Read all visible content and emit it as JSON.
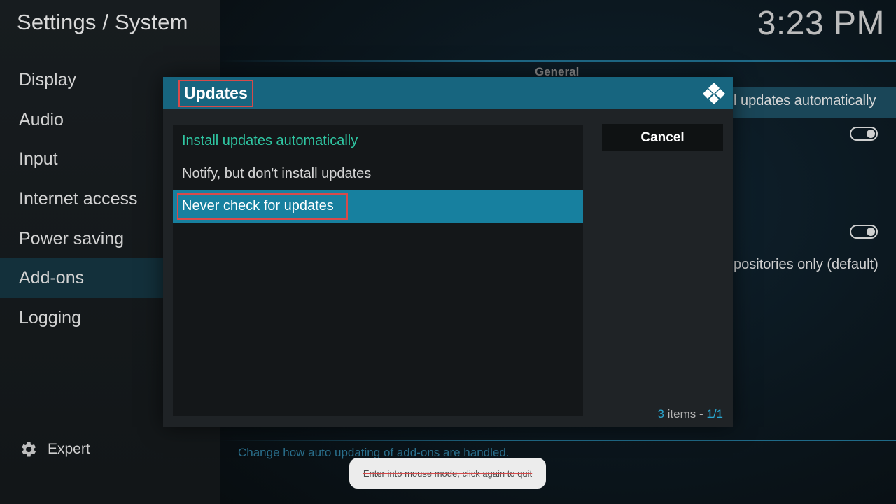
{
  "app": {
    "title": "Settings / System",
    "clock": "3:23 PM"
  },
  "sidebar": {
    "items": [
      {
        "label": "Display"
      },
      {
        "label": "Audio"
      },
      {
        "label": "Input"
      },
      {
        "label": "Internet access"
      },
      {
        "label": "Power saving"
      },
      {
        "label": "Add-ons"
      },
      {
        "label": "Logging"
      }
    ],
    "selected": "Add-ons",
    "expert_label": "Expert"
  },
  "background": {
    "section_header": "General",
    "row1_text": "l updates automatically",
    "row2_text": "positories only (default)",
    "hint": "Change how auto updating of add-ons are handled."
  },
  "dialog": {
    "title": "Updates",
    "options": [
      {
        "label": "Install updates automatically",
        "state": "current"
      },
      {
        "label": "Notify, but don't install updates",
        "state": "normal"
      },
      {
        "label": "Never check for updates",
        "state": "focused"
      }
    ],
    "cancel_label": "Cancel",
    "count_number": "3",
    "count_text": " items - ",
    "count_page": "1/1"
  },
  "toast": {
    "text": "Enter into mouse mode, click again to quit"
  },
  "colors": {
    "accent": "#17657f",
    "focus": "#17809f",
    "current_option": "#2fc7a3",
    "annotation": "#d64a4a"
  },
  "icons": [
    "gear-icon",
    "kodi-logo-icon"
  ]
}
